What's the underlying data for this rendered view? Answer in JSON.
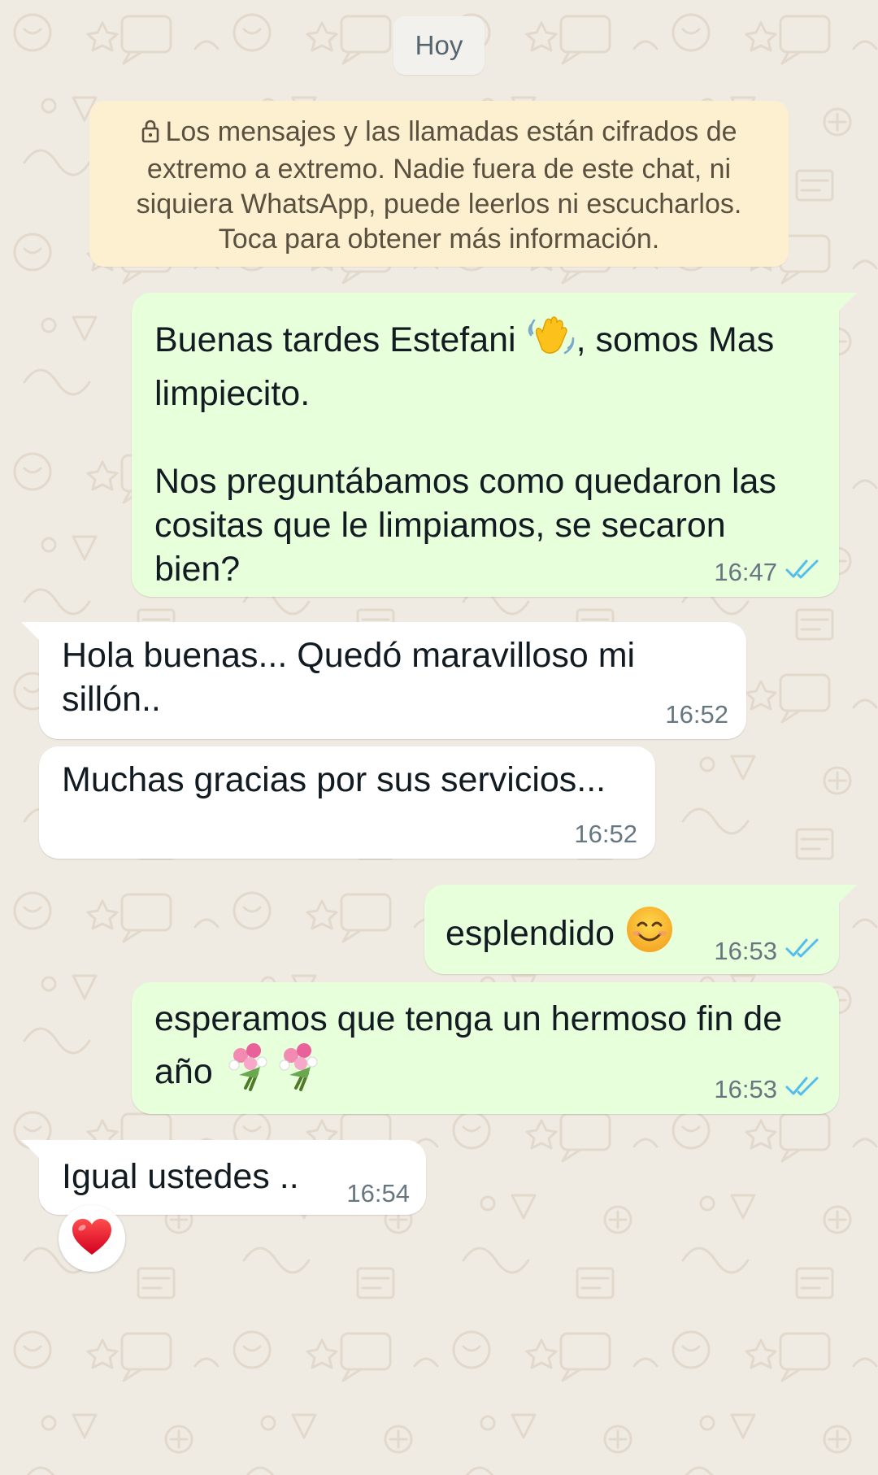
{
  "chat": {
    "date_chip": "Hoy",
    "encryption_notice": "Los mensajes y las llamadas están cifrados de extremo a extremo. Nadie fuera de este chat, ni siquiera WhatsApp, puede leerlos ni escucharlos. Toca para obtener más información.",
    "messages": [
      {
        "direction": "outgoing",
        "part1": "Buenas tardes Estefani ",
        "emoji": "waving-hand-icon",
        "part2": ", somos Mas\nlimpiecito.\n\nNos preguntábamos como quedaron las\ncositas que le limpiamos, se secaron\nbien?",
        "time": "16:47",
        "status": "read"
      },
      {
        "direction": "incoming",
        "text": "Hola buenas... Quedó maravilloso mi\nsillón..",
        "time": "16:52"
      },
      {
        "direction": "incoming",
        "text": "Muchas gracias por sus servicios...",
        "time": "16:52"
      },
      {
        "direction": "outgoing",
        "text": "esplendido ",
        "emoji": "smiling-face-icon",
        "time": "16:53",
        "status": "read"
      },
      {
        "direction": "outgoing",
        "part1": "esperamos que tenga un hermoso fin de\naño ",
        "emoji": "bouquet-icon",
        "time": "16:53",
        "status": "read"
      },
      {
        "direction": "incoming",
        "text": "Igual ustedes ..",
        "time": "16:54",
        "reaction": "red-heart-icon"
      }
    ]
  },
  "colors": {
    "wallpaper": "#efeae2",
    "outgoing_bubble": "#e7ffdb",
    "incoming_bubble": "#ffffff",
    "encryption_banner": "#fdf0d0",
    "read_ticks": "#53bdeb",
    "timestamp": "#667781"
  }
}
